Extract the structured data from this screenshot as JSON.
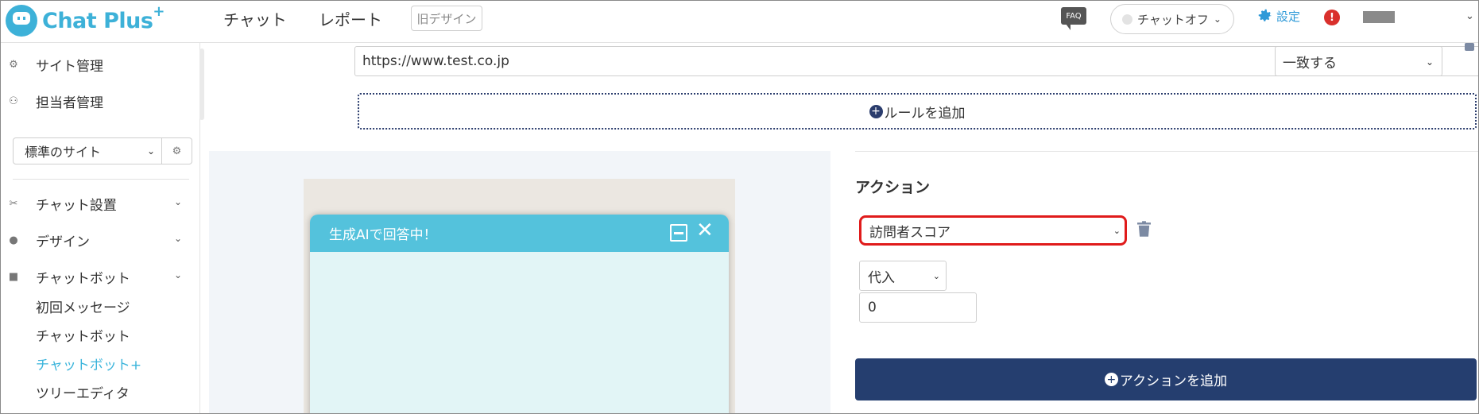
{
  "header": {
    "logo_text": "Chat Plus",
    "logo_plus": "+",
    "nav": [
      "チャット",
      "レポート"
    ],
    "old_design": "旧デザイン",
    "faq": "FAQ",
    "chat_status": "チャットオフ",
    "settings": "設定",
    "alert": "!"
  },
  "sidebar": {
    "top_items": [
      {
        "label": "サイト管理",
        "icon": "gear-icon"
      },
      {
        "label": "担当者管理",
        "icon": "user-gear-icon"
      }
    ],
    "site_select": "標準のサイト",
    "menu": [
      {
        "label": "チャット設置",
        "icon": "tools-icon"
      },
      {
        "label": "デザイン",
        "icon": "palette-icon"
      },
      {
        "label": "チャットボット",
        "icon": "chat-bubbles-icon"
      }
    ],
    "submenu": [
      {
        "label": "初回メッセージ",
        "active": false
      },
      {
        "label": "チャットボット",
        "active": false
      },
      {
        "label": "チャットボット+",
        "active": true
      },
      {
        "label": "ツリーエディタ",
        "active": false
      }
    ]
  },
  "main": {
    "url_value": "https://www.test.co.jp",
    "match_select": "一致する",
    "add_rule": "ルールを追加",
    "preview": {
      "title": "生成AIで回答中！"
    },
    "action": {
      "title": "アクション",
      "select": "訪問者スコア",
      "operator": "代入",
      "value": "0",
      "add_action": "アクションを追加"
    }
  },
  "colors": {
    "brand": "#3db1d8",
    "navy": "#253e6f",
    "highlight": "#e01b1b",
    "chat_header": "#54c2dc"
  }
}
